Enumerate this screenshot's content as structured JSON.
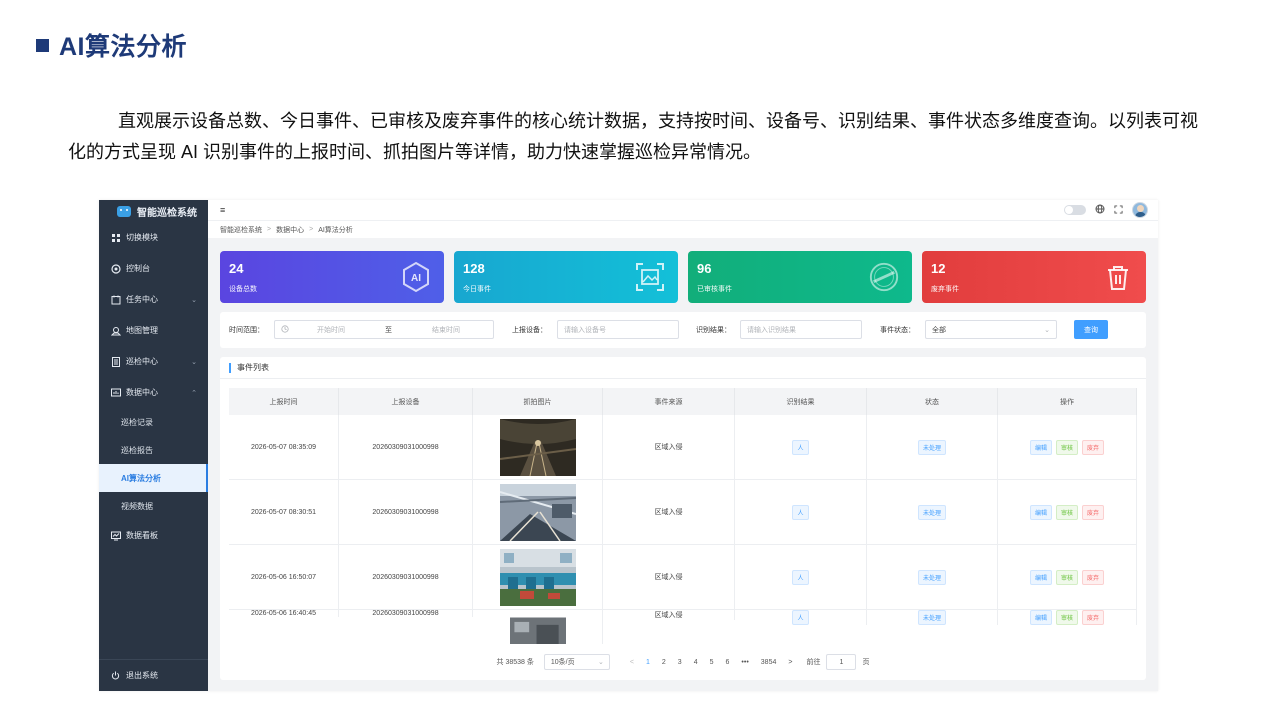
{
  "slide": {
    "title": "AI算法分析",
    "description": "直观展示设备总数、今日事件、已审核及废弃事件的核心统计数据，支持按时间、设备号、识别结果、事件状态多维度查询。以列表可视化的方式呈现 AI 识别事件的上报时间、抓拍图片等详情，助力快速掌握巡检异常情况。"
  },
  "app": {
    "name": "智能巡检系统",
    "sidebar": {
      "items": [
        {
          "label": "切换模块",
          "icon": "grid-icon"
        },
        {
          "label": "控制台",
          "icon": "dashboard-icon"
        },
        {
          "label": "任务中心",
          "icon": "task-icon"
        },
        {
          "label": "地图管理",
          "icon": "map-icon"
        },
        {
          "label": "巡检中心",
          "icon": "inspection-icon"
        },
        {
          "label": "数据中心",
          "icon": "data-icon"
        }
      ],
      "sub_items": [
        "巡检记录",
        "巡检报告",
        "AI算法分析",
        "视频数据"
      ],
      "dashboard": "数据看板",
      "logout": "退出系统"
    },
    "breadcrumb": [
      "智能巡检系统",
      "数据中心",
      "AI算法分析"
    ],
    "stats": [
      {
        "value": "24",
        "label": "设备总数",
        "color": "#5a45e0"
      },
      {
        "value": "128",
        "label": "今日事件",
        "color": "#18a7d0"
      },
      {
        "value": "96",
        "label": "已审核事件",
        "color": "#12ae7a"
      },
      {
        "value": "12",
        "label": "废弃事件",
        "color": "#e13d3d"
      }
    ],
    "filter": {
      "time_label": "时间范围：",
      "start_placeholder": "开始时间",
      "to": "至",
      "end_placeholder": "结束时间",
      "device_label": "上报设备：",
      "device_placeholder": "请输入设备号",
      "result_label": "识别结果：",
      "result_placeholder": "请输入识别结果",
      "status_label": "事件状态：",
      "status_value": "全部",
      "query_button": "查询"
    },
    "table": {
      "title": "事件列表",
      "headers": [
        "上报时间",
        "上报设备",
        "抓拍图片",
        "事件来源",
        "识别结果",
        "状态",
        "操作"
      ],
      "rows": [
        {
          "time": "2026-05-07 08:35:09",
          "device": "20260309031000998",
          "source": "区域入侵",
          "result": "人",
          "status": "未处理"
        },
        {
          "time": "2026-05-07 08:30:51",
          "device": "20260309031000998",
          "source": "区域入侵",
          "result": "人",
          "status": "未处理"
        },
        {
          "time": "2026-05-06 16:50:07",
          "device": "20260309031000998",
          "source": "区域入侵",
          "result": "人",
          "status": "未处理"
        },
        {
          "time": "2026-05-06 16:40:45",
          "device": "20260309031000998",
          "source": "区域入侵",
          "result": "人",
          "status": "未处理"
        }
      ],
      "actions": {
        "edit": "编辑",
        "review": "审核",
        "discard": "废弃"
      }
    },
    "pagination": {
      "total": "共 38538 条",
      "page_size": "10条/页",
      "pages": [
        "1",
        "2",
        "3",
        "4",
        "5",
        "6",
        "•••",
        "3854"
      ],
      "current": "1",
      "goto_label": "前往",
      "goto_value": "1",
      "page_unit": "页"
    }
  }
}
